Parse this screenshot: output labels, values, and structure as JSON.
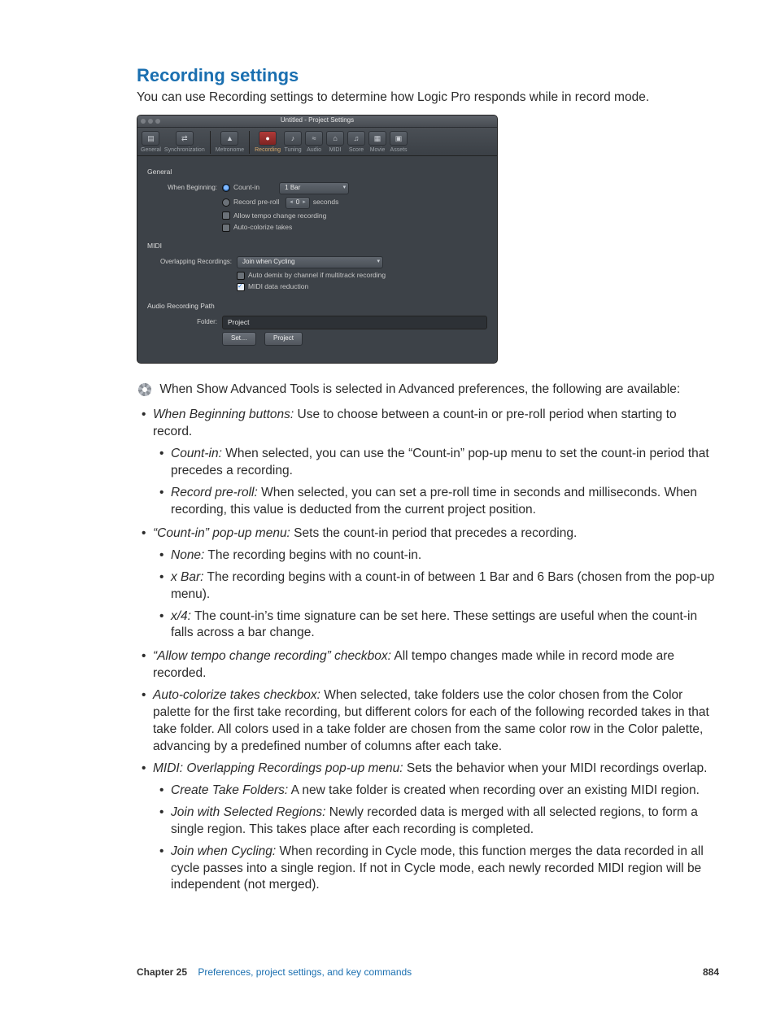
{
  "heading": "Recording settings",
  "intro": "You can use Recording settings to determine how Logic Pro responds while in record mode.",
  "window": {
    "title": "Untitled - Project Settings",
    "tabs": [
      "General",
      "Synchronization",
      "Metronome",
      "Recording",
      "Tuning",
      "Audio",
      "MIDI",
      "Score",
      "Movie",
      "Assets"
    ],
    "active_tab": "Recording",
    "general": {
      "section": "General",
      "when_beginning_label": "When Beginning:",
      "count_in_label": "Count-in",
      "count_in_menu": "1 Bar",
      "preroll_label": "Record pre-roll",
      "preroll_value": "0",
      "preroll_unit": "seconds",
      "allow_tempo": "Allow tempo change recording",
      "auto_colorize": "Auto-colorize takes"
    },
    "midi": {
      "section": "MIDI",
      "overlap_label": "Overlapping Recordings:",
      "overlap_menu": "Join when Cycling",
      "auto_demix": "Auto demix by channel if multitrack recording",
      "data_reduction": "MIDI data reduction"
    },
    "path": {
      "section": "Audio Recording Path",
      "folder_label": "Folder:",
      "folder_value": "Project",
      "set_button": "Set…",
      "project_button": "Project"
    }
  },
  "note_after_gear": "When Show Advanced Tools is selected in Advanced preferences, the following are available:",
  "bullets": {
    "b1_em": "When Beginning buttons:",
    "b1_txt": " Use to choose between a count-in or pre-roll period when starting to record.",
    "b1a_em": "Count-in:",
    "b1a_txt": " When selected, you can use the “Count-in” pop-up menu to set the count-in period that precedes a recording.",
    "b1b_em": "Record pre-roll:",
    "b1b_txt": " When selected, you can set a pre-roll time in seconds and milliseconds. When recording, this value is deducted from the current project position.",
    "b2_em": "“Count-in” pop-up menu:",
    "b2_txt": " Sets the count-in period that precedes a recording.",
    "b2a_em": "None:",
    "b2a_txt": " The recording begins with no count-in.",
    "b2b_em": "x Bar:",
    "b2b_txt": " The recording begins with a count-in of between 1 Bar and 6 Bars (chosen from the pop-up menu).",
    "b2c_em": "x/4:",
    "b2c_txt": " The count-in’s time signature can be set here. These settings are useful when the count-in falls across a bar change.",
    "b3_em": "“Allow tempo change recording” checkbox:",
    "b3_txt": " All tempo changes made while in record mode are recorded.",
    "b4_em": "Auto-colorize takes checkbox:",
    "b4_txt": " When selected, take folders use the color chosen from the Color palette for the first take recording, but different colors for each of the following recorded takes in that take folder. All colors used in a take folder are chosen from the same color row in the Color palette, advancing by a predefined number of columns after each take.",
    "b5_em": "MIDI: Overlapping Recordings pop-up menu:",
    "b5_txt": " Sets the behavior when your MIDI recordings overlap.",
    "b5a_em": "Create Take Folders:",
    "b5a_txt": " A new take folder is created when recording over an existing MIDI region.",
    "b5b_em": "Join with Selected Regions:",
    "b5b_txt": " Newly recorded data is merged with all selected regions, to form a single region. This takes place after each recording is completed.",
    "b5c_em": "Join when Cycling:",
    "b5c_txt": " When recording in Cycle mode, this function merges the data recorded in all cycle passes into a single region. If not in Cycle mode, each newly recorded MIDI region will be independent (not merged)."
  },
  "footer": {
    "chapter_label": "Chapter  25",
    "chapter_name": "Preferences, project settings, and key commands",
    "page": "884"
  }
}
